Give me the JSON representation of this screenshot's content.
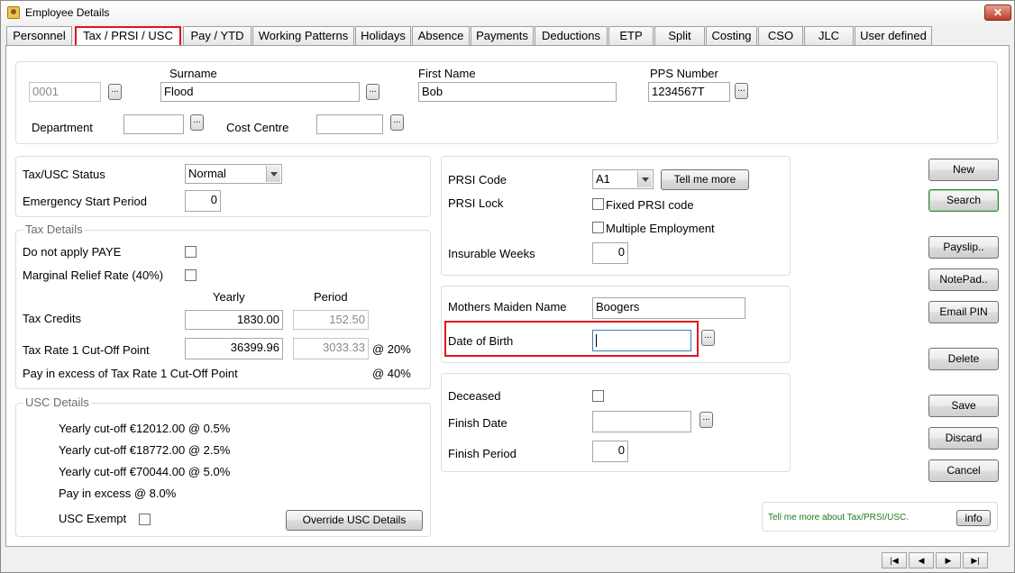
{
  "window": {
    "title": "Employee Details",
    "close_label": "✕"
  },
  "tabs": [
    {
      "label": "Personnel"
    },
    {
      "label": "Tax / PRSI / USC"
    },
    {
      "label": "Pay / YTD"
    },
    {
      "label": "Working Patterns"
    },
    {
      "label": "Holidays"
    },
    {
      "label": "Absence"
    },
    {
      "label": "Payments"
    },
    {
      "label": "Deductions"
    },
    {
      "label": "ETP"
    },
    {
      "label": "Split"
    },
    {
      "label": "Costing"
    },
    {
      "label": "CSO"
    },
    {
      "label": "JLC"
    },
    {
      "label": "User defined"
    }
  ],
  "active_tab": "Tax / PRSI / USC",
  "header": {
    "employee_no": "0001",
    "surname_label": "Surname",
    "surname": "Flood",
    "first_name_label": "First Name",
    "first_name": "Bob",
    "pps_label": "PPS Number",
    "pps": "1234567T",
    "department_label": "Department",
    "department": "",
    "cost_centre_label": "Cost Centre",
    "cost_centre": "",
    "ellipsis": "..."
  },
  "tax_status": {
    "status_label": "Tax/USC Status",
    "status_value": "Normal",
    "emergency_label": "Emergency Start Period",
    "emergency_value": "0"
  },
  "tax_details": {
    "title": "Tax Details",
    "no_paye_label": "Do not apply PAYE",
    "no_paye_checked": false,
    "marginal_label": "Marginal Relief Rate (40%)",
    "marginal_checked": false,
    "yearly_header": "Yearly",
    "period_header": "Period",
    "tax_credits_label": "Tax Credits",
    "tax_credits_yearly": "1830.00",
    "tax_credits_period": "152.50",
    "cutoff_label": "Tax Rate 1 Cut-Off Point",
    "cutoff_yearly": "36399.96",
    "cutoff_period": "3033.33",
    "rate1": "@ 20%",
    "excess_label": "Pay in excess of Tax Rate 1 Cut-Off Point",
    "rate2": "@ 40%"
  },
  "usc_details": {
    "title": "USC Details",
    "lines": [
      "Yearly cut-off €12012.00 @ 0.5%",
      "Yearly cut-off €18772.00 @ 2.5%",
      "Yearly cut-off €70044.00 @ 5.0%",
      "Pay in excess @ 8.0%"
    ],
    "exempt_label": "USC Exempt",
    "exempt_checked": false,
    "override_button": "Override USC Details"
  },
  "prsi": {
    "code_label": "PRSI Code",
    "code_value": "A1",
    "tell_me_more": "Tell me more",
    "lock_label": "PRSI Lock",
    "fixed_label": "Fixed PRSI code",
    "fixed_checked": false,
    "multiple_label": "Multiple Employment",
    "multiple_checked": false,
    "insurable_label": "Insurable Weeks",
    "insurable_value": "0"
  },
  "personal": {
    "maiden_label": "Mothers Maiden Name",
    "maiden_value": "Boogers",
    "dob_label": "Date of Birth",
    "dob_value": ""
  },
  "leaving": {
    "deceased_label": "Deceased",
    "deceased_checked": false,
    "finish_date_label": "Finish Date",
    "finish_date": "",
    "finish_period_label": "Finish Period",
    "finish_period": "0"
  },
  "actions": {
    "new": "New",
    "search": "Search",
    "payslip": "Payslip..",
    "notepad": "NotePad..",
    "email_pin": "Email PIN",
    "delete": "Delete",
    "save": "Save",
    "discard": "Discard",
    "cancel": "Cancel"
  },
  "info_box": {
    "text": "Tell me more about Tax/PRSI/USC.",
    "button": "info"
  },
  "navigation": {
    "first": "|◀",
    "prev": "◀",
    "next": "▶",
    "last": "▶|"
  }
}
